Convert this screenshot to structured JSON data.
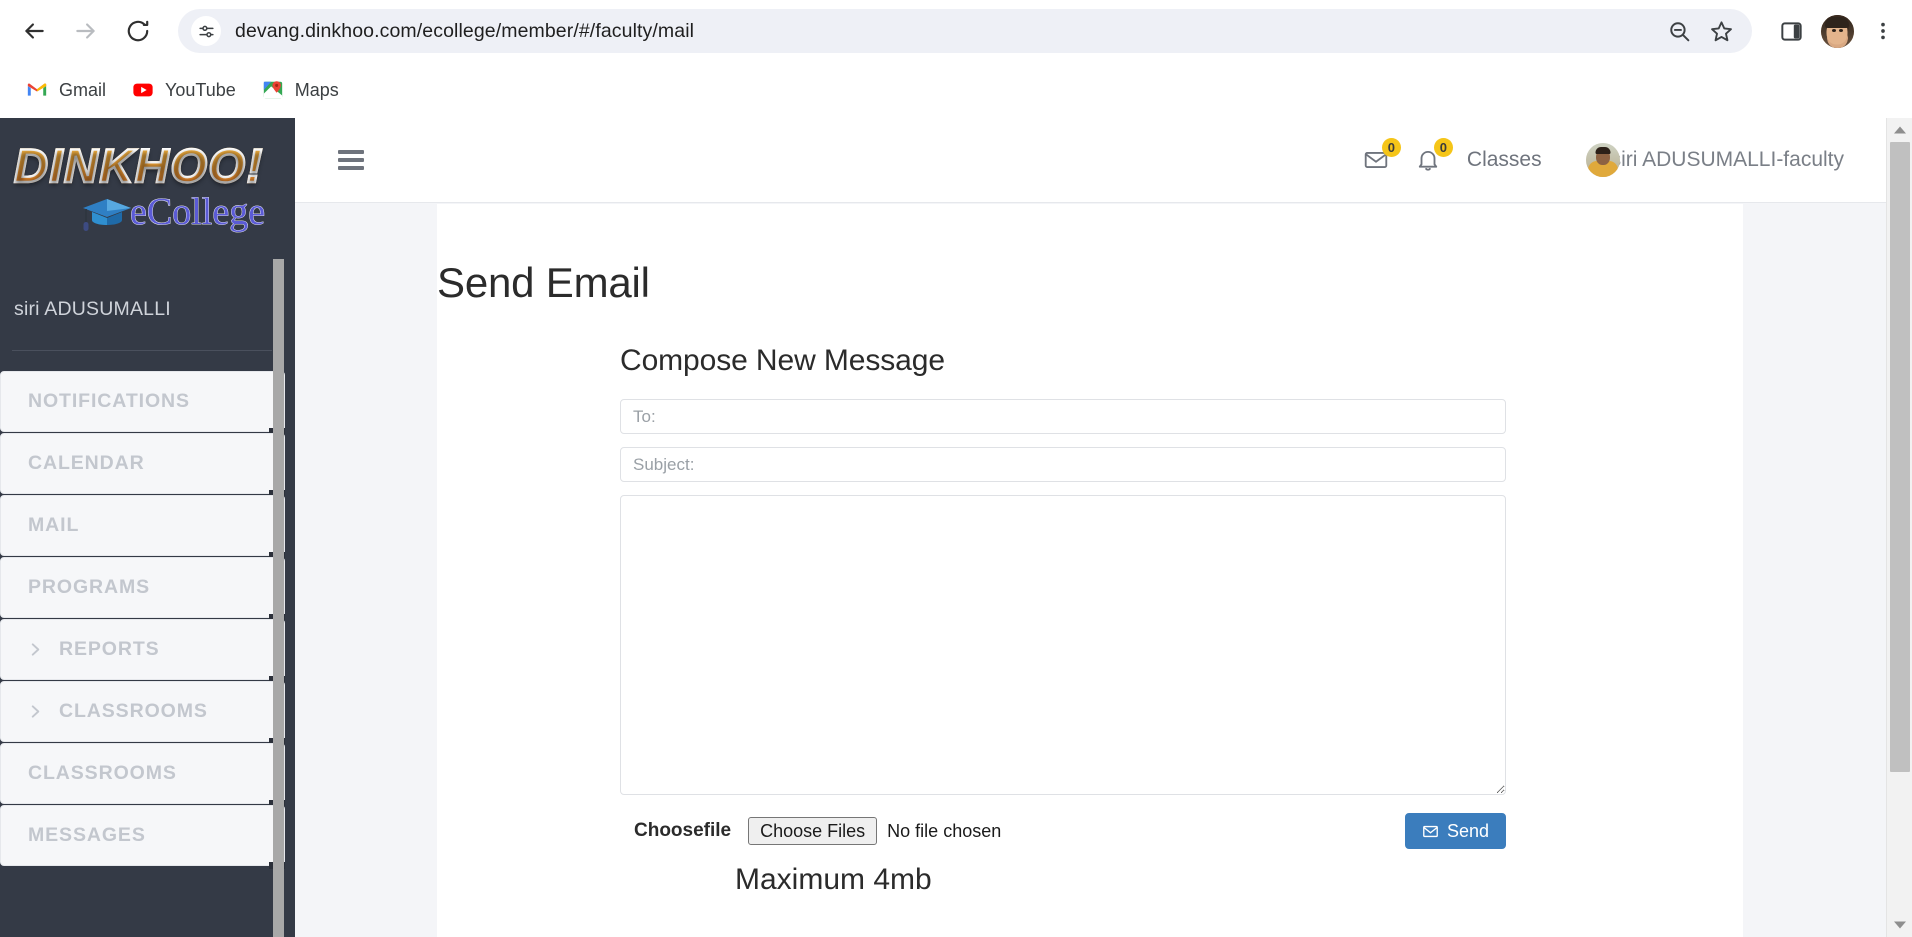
{
  "browser": {
    "back_label": "Back",
    "forward_label": "Forward",
    "reload_label": "Reload",
    "url": "devang.dinkhoo.com/ecollege/member/#/faculty/mail",
    "site_info_icon": "site-settings-icon",
    "zoom_out_icon": "zoom-out-icon",
    "bookmark_icon": "bookmark-star-icon",
    "side_panel_icon": "side-panel-icon",
    "profile_icon": "profile-avatar-icon",
    "menu_icon": "three-dot-menu-icon",
    "bookmarks": [
      {
        "label": "Gmail",
        "icon": "gmail-icon"
      },
      {
        "label": "YouTube",
        "icon": "youtube-icon"
      },
      {
        "label": "Maps",
        "icon": "google-maps-icon"
      }
    ]
  },
  "sidebar": {
    "logo_main": "DINKHOO!",
    "logo_sub": "eCollege",
    "logo_cap_icon": "graduation-cap-icon",
    "user_name": "siri ADUSUMALLI",
    "items": [
      {
        "label": "NOTIFICATIONS",
        "expandable": false
      },
      {
        "label": "CALENDAR",
        "expandable": false
      },
      {
        "label": "MAIL",
        "expandable": false
      },
      {
        "label": "PROGRAMS",
        "expandable": false
      },
      {
        "label": "REPORTS",
        "expandable": true
      },
      {
        "label": "CLASSROOMS",
        "expandable": true
      },
      {
        "label": "CLASSROOMS",
        "expandable": false
      },
      {
        "label": "MESSAGES",
        "expandable": false
      }
    ]
  },
  "topbar": {
    "menu_toggle_icon": "hamburger-menu-icon",
    "mail_icon": "envelope-icon",
    "mail_count": "0",
    "bell_icon": "bell-icon",
    "bell_count": "0",
    "classes_label": "Classes",
    "user_label": "siri ADUSUMALLI-faculty"
  },
  "main": {
    "page_title": "Send Email",
    "compose_title": "Compose New Message",
    "to_placeholder": "To:",
    "to_value": "",
    "subject_placeholder": "Subject:",
    "subject_value": "",
    "message_value": "",
    "choose_file_label": "Choosefile",
    "choose_files_button": "Choose Files",
    "no_file_text": "No file chosen",
    "send_label": "Send",
    "send_icon": "envelope-icon",
    "max_size_note": "Maximum 4mb"
  },
  "colors": {
    "sidebar_bg": "#343a46",
    "accent_blue": "#3b7dbd",
    "badge_yellow": "#f5c518",
    "page_bg": "#f4f5f8",
    "logo_orange": "#f0932b",
    "logo_purple": "#5b5bd6"
  }
}
